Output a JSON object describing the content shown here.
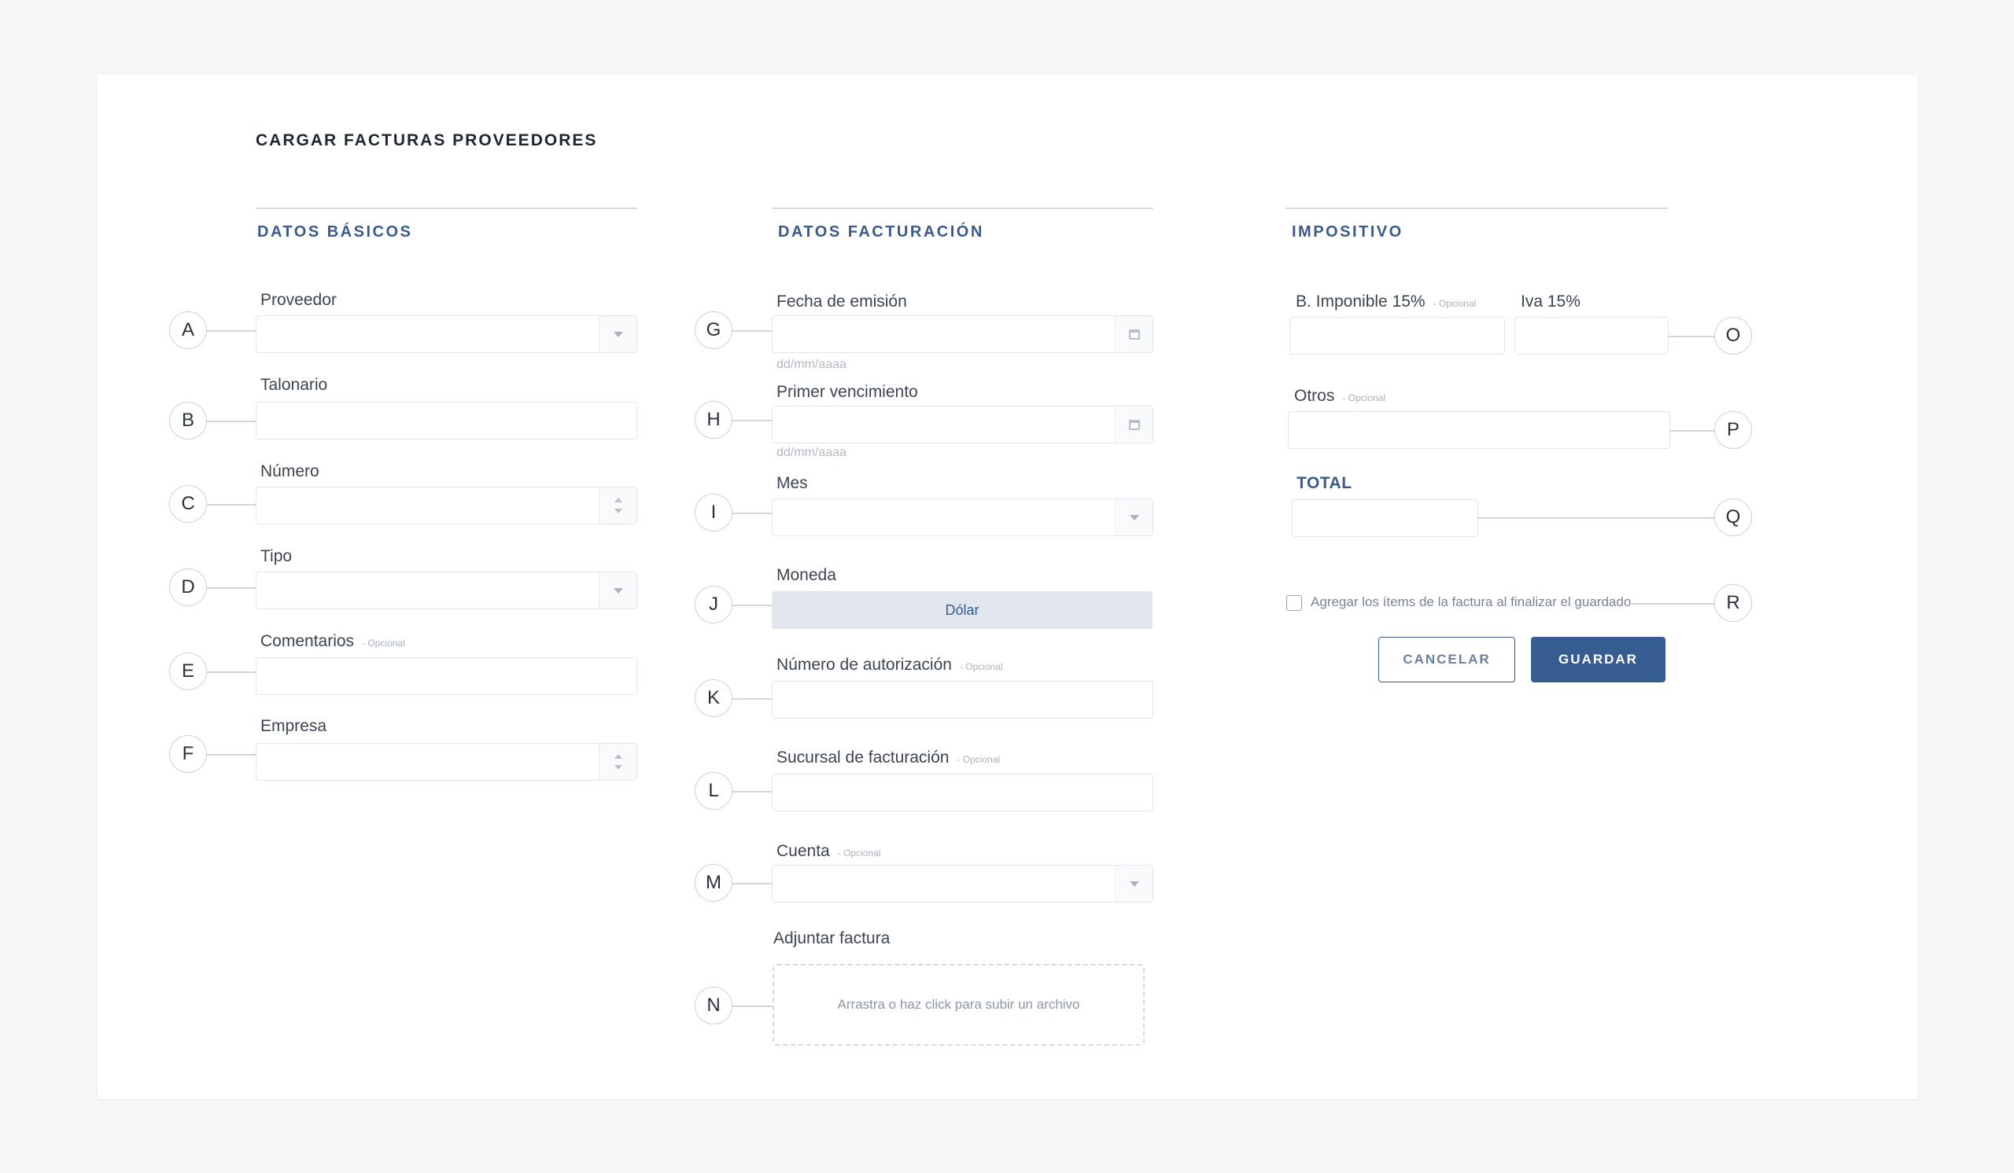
{
  "page": {
    "title": "CARGAR FACTURAS PROVEEDORES"
  },
  "sections": {
    "basicos": "DATOS BÁSICOS",
    "facturacion": "DATOS FACTURACIÓN",
    "impositivo": "IMPOSITIVO"
  },
  "optional_tag": "- Opcional",
  "fields": {
    "proveedor": "Proveedor",
    "talonario": "Talonario",
    "numero": "Número",
    "tipo": "Tipo",
    "comentarios": "Comentarios",
    "empresa": "Empresa",
    "fecha_emision": "Fecha de emisión",
    "primer_vencimiento": "Primer vencimiento",
    "mes": "Mes",
    "moneda": "Moneda",
    "numero_autorizacion": "Número de autorización",
    "sucursal_facturacion": "Sucursal de facturación",
    "cuenta": "Cuenta",
    "adjuntar_factura": "Adjuntar factura",
    "b_imponible": "B. Imponible 15%",
    "iva": "Iva 15%",
    "otros": "Otros",
    "total": "TOTAL"
  },
  "date_hint": "dd/mm/aaaa",
  "moneda_value": "Dólar",
  "upload_text": "Arrastra o haz click para subir un archivo",
  "checkbox_label": "Agregar los ítems de la factura al finalizar el guardado",
  "buttons": {
    "cancel": "CANCELAR",
    "save": "GUARDAR"
  },
  "markers": [
    "A",
    "B",
    "C",
    "D",
    "E",
    "F",
    "G",
    "H",
    "I",
    "J",
    "K",
    "L",
    "M",
    "N",
    "O",
    "P",
    "Q",
    "R"
  ]
}
